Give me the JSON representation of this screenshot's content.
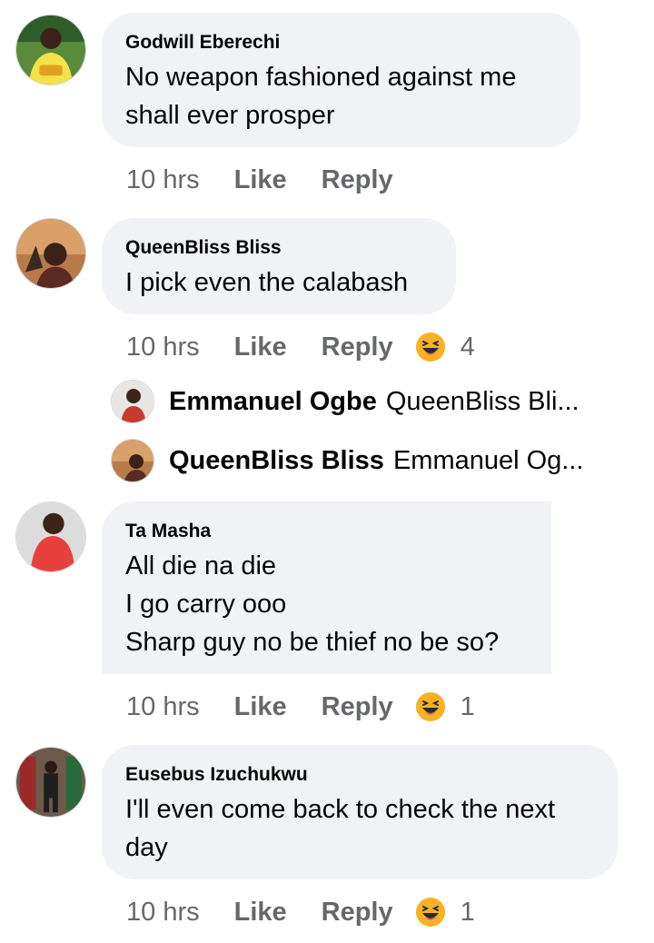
{
  "comments": [
    {
      "name": "Godwill Eberechi",
      "text": "No weapon fashioned against me\nshall ever prosper",
      "time": "10 hrs",
      "like": "Like",
      "reply": "Reply",
      "avatar_icon": "profile-photo"
    },
    {
      "name": "QueenBliss Bliss",
      "text": "I pick even the calabash",
      "time": "10 hrs",
      "like": "Like",
      "reply": "Reply",
      "reaction_icon": "haha-emoji",
      "reaction_count": "4",
      "replies": [
        {
          "name": "Emmanuel Ogbe",
          "preview": "QueenBliss Bli..."
        },
        {
          "name": "QueenBliss Bliss",
          "preview": "Emmanuel Og..."
        }
      ]
    },
    {
      "name": "Ta Masha",
      "text": "All die na die\nI go carry ooo\nSharp guy no be thief no be so?",
      "time": "10 hrs",
      "like": "Like",
      "reply": "Reply",
      "reaction_icon": "haha-emoji",
      "reaction_count": "1"
    },
    {
      "name": "Eusebus Izuchukwu",
      "text": "I'll even come back to check the next\nday",
      "time": "10 hrs",
      "like": "Like",
      "reply": "Reply",
      "reaction_icon": "haha-emoji",
      "reaction_count": "1"
    }
  ],
  "colors": {
    "bubble": "#f0f2f5",
    "meta_text": "#65676b",
    "emoji": "#f7b125"
  }
}
